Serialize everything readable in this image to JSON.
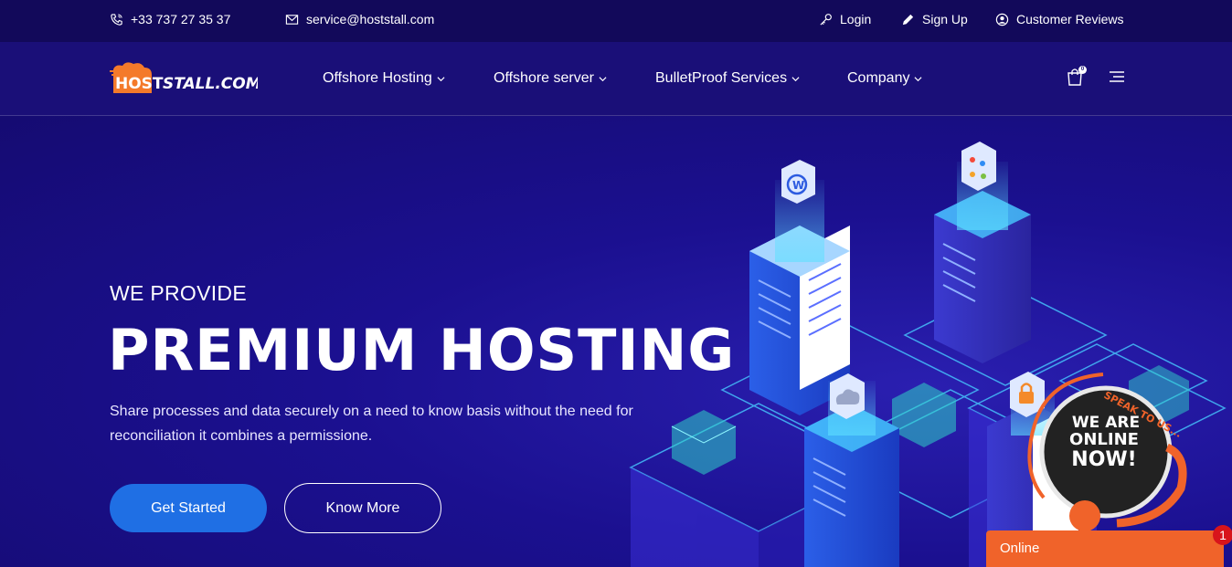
{
  "topbar": {
    "phone": "+33 737 27 35 37",
    "email": "service@hoststall.com",
    "login": "Login",
    "signup": "Sign Up",
    "reviews": "Customer Reviews"
  },
  "nav": {
    "logo_text": "HOST STALL.COM",
    "items": [
      "Offshore Hosting",
      "Offshore server",
      "BulletProof Services",
      "Company"
    ],
    "cart_count": "0"
  },
  "hero": {
    "eyebrow": "WE PROVIDE",
    "headline": "PREMIUM HOSTING",
    "description": "Share processes and data securely on a need to know basis without the need for reconciliation it combines a permissione.",
    "primary_button": "Get Started",
    "secondary_button": "Know More"
  },
  "chat": {
    "badge_line1": "WE ARE",
    "badge_line2": "ONLINE",
    "badge_line3": "NOW!",
    "badge_curve": "SPEAK TO US...",
    "status": "Online",
    "unread": "1"
  },
  "colors": {
    "topbar_bg": "#12095a",
    "hero_bg": "#1a0f78",
    "primary_button": "#1f6fe4",
    "chat_orange": "#f0632a",
    "logo_orange": "#f47a2a"
  }
}
